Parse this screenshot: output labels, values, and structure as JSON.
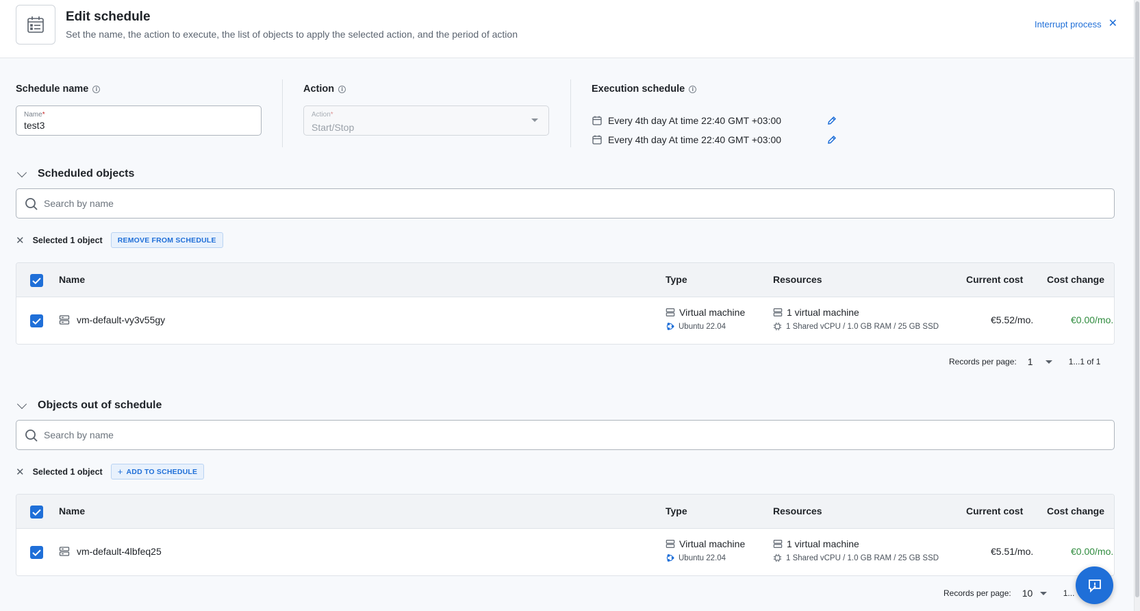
{
  "header": {
    "title": "Edit schedule",
    "subtitle": "Set the name, the action to execute, the list of objects to apply the selected action, and the period of action",
    "interrupt_label": "Interrupt process"
  },
  "schedule_name": {
    "label": "Schedule name",
    "field_label": "Name",
    "value": "test3"
  },
  "action": {
    "label": "Action",
    "field_label": "Action",
    "value": "Start/Stop"
  },
  "execution": {
    "label": "Execution schedule",
    "entries": [
      "Every 4th day At time 22:40 GMT +03:00",
      "Every 4th day At time 22:40 GMT +03:00"
    ]
  },
  "scheduled": {
    "title": "Scheduled objects",
    "search_placeholder": "Search by name",
    "selected_text": "Selected 1 object",
    "action_button": "REMOVE FROM SCHEDULE",
    "columns": {
      "name": "Name",
      "type": "Type",
      "resources": "Resources",
      "current_cost": "Current cost",
      "cost_change": "Cost change"
    },
    "rows": [
      {
        "name": "vm-default-vy3v55gy",
        "type": "Virtual machine",
        "os": "Ubuntu 22.04",
        "resources": "1 virtual machine",
        "specs": "1 Shared vCPU / 1.0 GB RAM / 25 GB SSD",
        "current_cost": "€5.52/mo.",
        "cost_change": "€0.00/mo."
      }
    ],
    "pager": {
      "label": "Records per page:",
      "per_page": "1",
      "range": "1...1 of 1"
    }
  },
  "unscheduled": {
    "title": "Objects out of schedule",
    "search_placeholder": "Search by name",
    "selected_text": "Selected 1 object",
    "action_button": "ADD TO SCHEDULE",
    "columns": {
      "name": "Name",
      "type": "Type",
      "resources": "Resources",
      "current_cost": "Current cost",
      "cost_change": "Cost change"
    },
    "rows": [
      {
        "name": "vm-default-4lbfeq25",
        "type": "Virtual machine",
        "os": "Ubuntu 22.04",
        "resources": "1 virtual machine",
        "specs": "1 Shared vCPU / 1.0 GB RAM / 25 GB SSD",
        "current_cost": "€5.51/mo.",
        "cost_change": "€0.00/mo."
      }
    ],
    "pager": {
      "label": "Records per page:",
      "per_page": "10",
      "range": "1..."
    }
  },
  "colors": {
    "accent": "#1f6fd8",
    "positive": "#2e8b3d"
  }
}
